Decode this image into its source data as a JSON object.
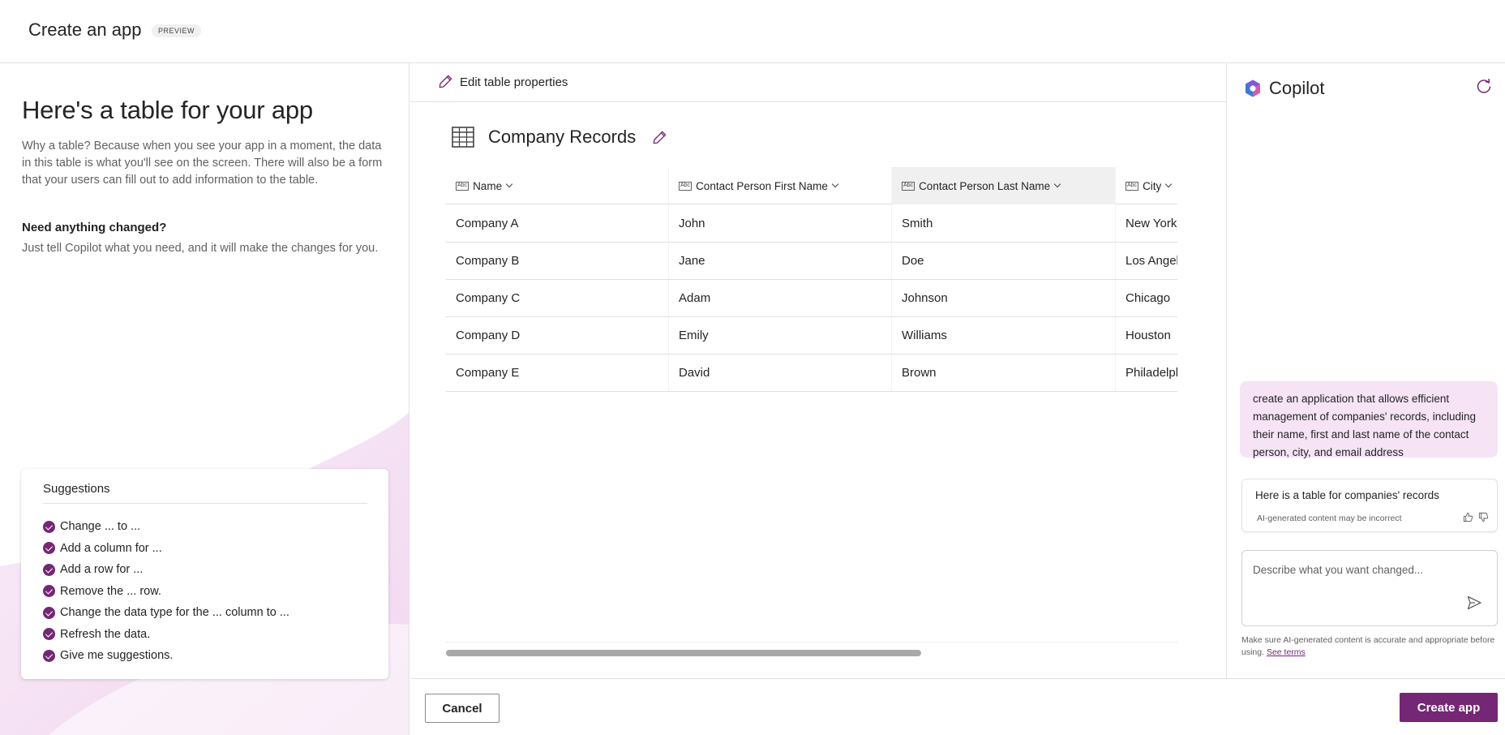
{
  "header": {
    "title": "Create an app",
    "badge": "PREVIEW"
  },
  "left": {
    "heading": "Here's a table for your app",
    "description": "Why a table? Because when you see your app in a moment, the data in this table is what you'll see on the screen. There will also be a form that your users can fill out to add information to the table.",
    "need_title": "Need anything changed?",
    "need_desc": "Just tell Copilot what you need, and it will make the changes for you.",
    "suggestions_title": "Suggestions",
    "suggestions": [
      "Change ... to ...",
      "Add a column for ...",
      "Add a row for ...",
      "Remove the ... row.",
      "Change the data type for the ... column to ...",
      "Refresh the data.",
      "Give me suggestions."
    ]
  },
  "center": {
    "edit_properties": "Edit table properties",
    "table_name": "Company Records",
    "columns": [
      "Name",
      "Contact Person First Name",
      "Contact Person Last Name",
      "City"
    ],
    "column_type_icon": "Abc",
    "rows": [
      [
        "Company A",
        "John",
        "Smith",
        "New York"
      ],
      [
        "Company B",
        "Jane",
        "Doe",
        "Los Angeles"
      ],
      [
        "Company C",
        "Adam",
        "Johnson",
        "Chicago"
      ],
      [
        "Company D",
        "Emily",
        "Williams",
        "Houston"
      ],
      [
        "Company E",
        "David",
        "Brown",
        "Philadelphia"
      ]
    ]
  },
  "footer": {
    "cancel": "Cancel",
    "create": "Create app"
  },
  "copilot": {
    "title": "Copilot",
    "user_message": "create an application that allows efficient management of companies' records, including their name, first and last name of the contact person, city, and email address",
    "bot_message": "Here is a table for companies' records",
    "bot_disclaimer": "AI-generated content may be incorrect",
    "input_placeholder": "Describe what you want changed...",
    "footer_text": "Make sure AI-generated content is accurate and appropriate before using.",
    "footer_link": "See terms"
  },
  "colors": {
    "accent": "#742774",
    "user_bubble": "#f6e3f6"
  }
}
